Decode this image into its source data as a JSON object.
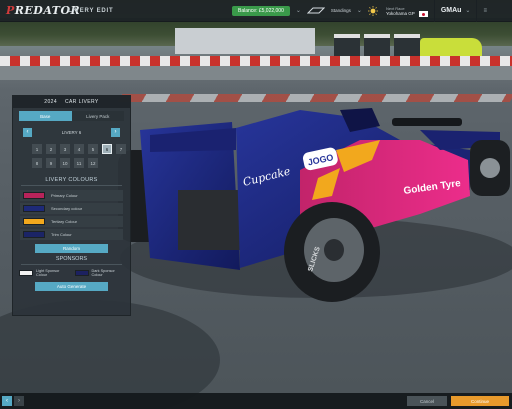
{
  "topbar": {
    "logo": "PREDATOR",
    "logo_first_letter": "P",
    "logo_rest": "REDATOR",
    "screen_title": "LIVERY EDIT",
    "balance": "Balance: £5,022,000",
    "weather": "Standings",
    "next_race_label": "Next Race",
    "next_race_location": "Yokohama GP",
    "brand": "GMAu",
    "colors": {
      "balance_bg": "#3a9a4a",
      "accent": "#56a9c4"
    }
  },
  "panel": {
    "year": "2024",
    "title": "CAR LIVERY",
    "tabs": [
      {
        "label": "Base",
        "active": true
      },
      {
        "label": "Livery Pack",
        "active": false
      }
    ],
    "livery_label": "LIVERY 6",
    "numbers": [
      "1",
      "2",
      "3",
      "4",
      "5",
      "6",
      "7",
      "8",
      "9",
      "10",
      "11",
      "12"
    ],
    "selected_number": "6",
    "colours_title": "LIVERY COLOURS",
    "colours": [
      {
        "label": "Primary Colour",
        "color": "#b8235a"
      },
      {
        "label": "Secondary colour",
        "color": "#1e2a78"
      },
      {
        "label": "Tertiary Colour",
        "color": "#f2a81d"
      },
      {
        "label": "Trim Colour",
        "color": "#1b2466"
      }
    ],
    "random_label": "Random",
    "sponsors_title": "SPONSORS",
    "sponsors": [
      {
        "label": "Light Sponsor Colour",
        "color": "#f2f2f2"
      },
      {
        "label": "Dark Sponsor Colour",
        "color": "#1c2160"
      }
    ],
    "auto_generate_label": "Auto Generate"
  },
  "car": {
    "sponsor_main": "Cupcake",
    "sponsor_side": "Golden Tyre",
    "sponsor_badge": "JOGO",
    "tyre_text": "SLICKS"
  },
  "bottombar": {
    "cancel_label": "Cancel",
    "continue_label": "Continue",
    "colors": {
      "continue_bg": "#e89a2c"
    }
  }
}
